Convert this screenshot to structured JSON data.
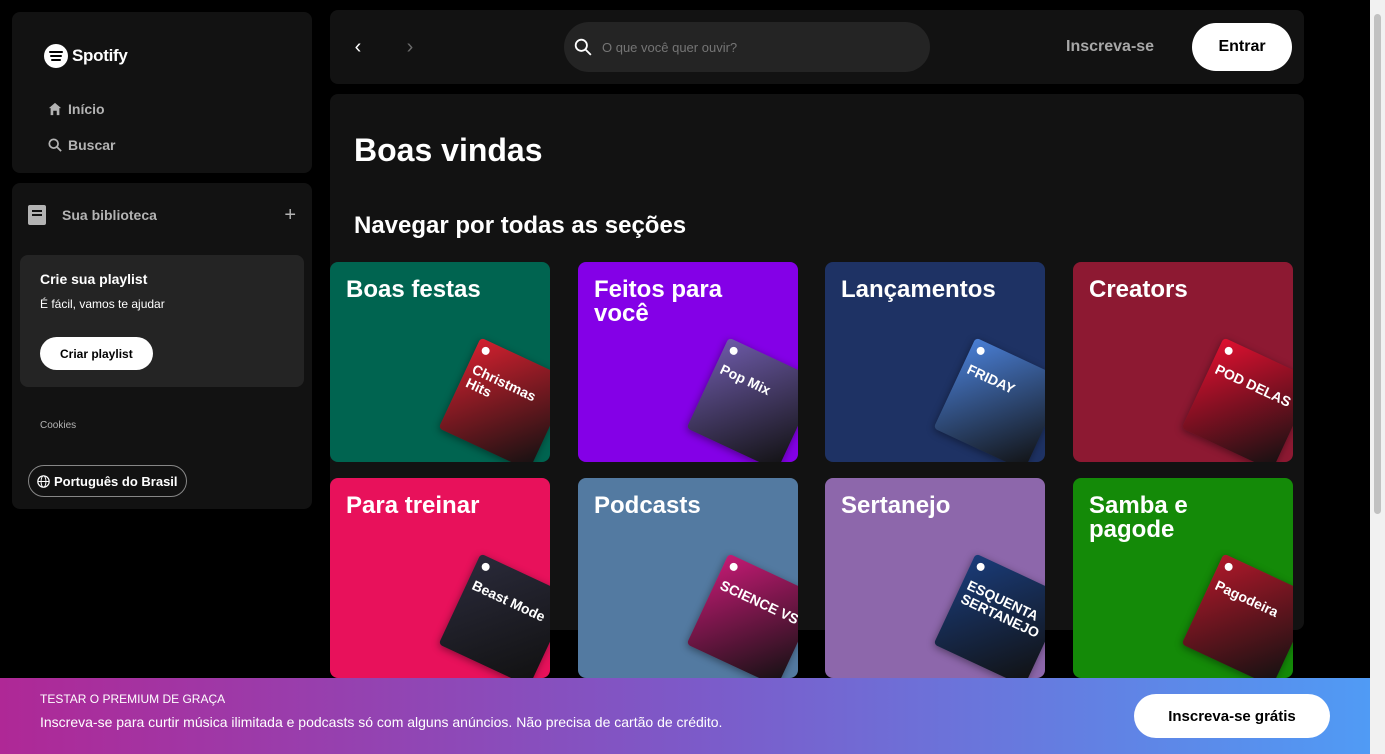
{
  "brand": {
    "name": "Spotify"
  },
  "nav": {
    "home": "Início",
    "search": "Buscar"
  },
  "library": {
    "title": "Sua biblioteca",
    "add": "+",
    "playlist_card": {
      "title": "Crie sua playlist",
      "subtitle": "É fácil, vamos te ajudar",
      "button": "Criar playlist"
    },
    "cookies": "Cookies",
    "language": "Português do Brasil"
  },
  "topbar": {
    "back": "‹",
    "forward": "›",
    "search_placeholder": "O que você quer ouvir?",
    "signup": "Inscreva-se",
    "login": "Entrar"
  },
  "main": {
    "welcome": "Boas vindas",
    "section_title": "Navegar por todas as seções",
    "tiles": [
      {
        "title": "Boas festas",
        "color": "#006450",
        "art_color": "#d3202f",
        "art_text": "Christmas Hits"
      },
      {
        "title": "Feitos para você",
        "color": "#8400e7",
        "art_color": "#6d5aa8",
        "art_text": "Pop Mix"
      },
      {
        "title": "Lançamentos",
        "color": "#1e3264",
        "art_color": "#4a7fd6",
        "art_text": "FRIDAY"
      },
      {
        "title": "Creators",
        "color": "#8d1932",
        "art_color": "#e01030",
        "art_text": "POD DELAS"
      },
      {
        "title": "Para treinar",
        "color": "#e8115b",
        "art_color": "#2a2a3a",
        "art_text": "Beast Mode"
      },
      {
        "title": "Podcasts",
        "color": "#537aa1",
        "art_color": "#c41a74",
        "art_text": "SCIENCE VS"
      },
      {
        "title": "Sertanejo",
        "color": "#8d67ab",
        "art_color": "#1a3c7a",
        "art_text": "ESQUENTA SERTANEJO"
      },
      {
        "title": "Samba e pagode",
        "color": "#148a08",
        "art_color": "#b0182a",
        "art_text": "Pagodeira"
      }
    ]
  },
  "banner": {
    "kicker": "TESTAR O PREMIUM DE GRAÇA",
    "text": "Inscreva-se para curtir música ilimitada e podcasts só com alguns anúncios. Não precisa de cartão de crédito.",
    "button": "Inscreva-se grátis"
  }
}
